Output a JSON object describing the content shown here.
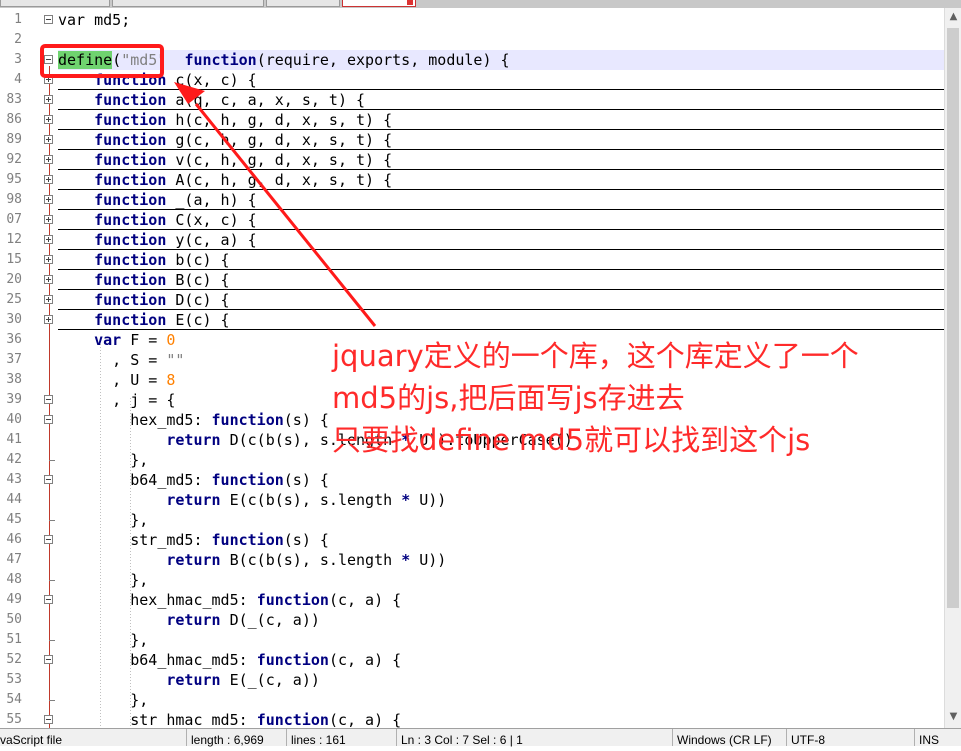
{
  "lines": [
    {
      "num": "1",
      "tokens": [
        {
          "t": "var md5;",
          "c": ""
        }
      ]
    },
    {
      "num": "2",
      "tokens": []
    },
    {
      "num": "3",
      "tokens": [
        {
          "t": "define",
          "c": "hl-define"
        },
        {
          "t": "(",
          "c": ""
        },
        {
          "t": "\"md5\"",
          "c": "str"
        },
        {
          "t": "  ",
          "c": ""
        },
        {
          "t": "function",
          "c": "kw"
        },
        {
          "t": "(require, exports, module) {",
          "c": ""
        }
      ]
    },
    {
      "num": "4",
      "tokens": [
        {
          "t": "    ",
          "c": ""
        },
        {
          "t": "function",
          "c": "kw"
        },
        {
          "t": " c(x, c) {",
          "c": ""
        }
      ]
    },
    {
      "num": "83",
      "tokens": [
        {
          "t": "    ",
          "c": ""
        },
        {
          "t": "function",
          "c": "kw"
        },
        {
          "t": " a(q, c, a, x, s, t) {",
          "c": ""
        }
      ]
    },
    {
      "num": "86",
      "tokens": [
        {
          "t": "    ",
          "c": ""
        },
        {
          "t": "function",
          "c": "kw"
        },
        {
          "t": " h(c, h, g, d, x, s, t) {",
          "c": ""
        }
      ]
    },
    {
      "num": "89",
      "tokens": [
        {
          "t": "    ",
          "c": ""
        },
        {
          "t": "function",
          "c": "kw"
        },
        {
          "t": " g(c, h, g, d, x, s, t) {",
          "c": ""
        }
      ]
    },
    {
      "num": "92",
      "tokens": [
        {
          "t": "    ",
          "c": ""
        },
        {
          "t": "function",
          "c": "kw"
        },
        {
          "t": " v(c, h, g, d, x, s, t) {",
          "c": ""
        }
      ]
    },
    {
      "num": "95",
      "tokens": [
        {
          "t": "    ",
          "c": ""
        },
        {
          "t": "function",
          "c": "kw"
        },
        {
          "t": " A(c, h, g, d, x, s, t) {",
          "c": ""
        }
      ]
    },
    {
      "num": "98",
      "tokens": [
        {
          "t": "    ",
          "c": ""
        },
        {
          "t": "function",
          "c": "kw"
        },
        {
          "t": " _(a, h) {",
          "c": ""
        }
      ]
    },
    {
      "num": "07",
      "tokens": [
        {
          "t": "    ",
          "c": ""
        },
        {
          "t": "function",
          "c": "kw"
        },
        {
          "t": " C(x, c) {",
          "c": ""
        }
      ]
    },
    {
      "num": "12",
      "tokens": [
        {
          "t": "    ",
          "c": ""
        },
        {
          "t": "function",
          "c": "kw"
        },
        {
          "t": " y(c, a) {",
          "c": ""
        }
      ]
    },
    {
      "num": "15",
      "tokens": [
        {
          "t": "    ",
          "c": ""
        },
        {
          "t": "function",
          "c": "kw"
        },
        {
          "t": " b(c) {",
          "c": ""
        }
      ]
    },
    {
      "num": "20",
      "tokens": [
        {
          "t": "    ",
          "c": ""
        },
        {
          "t": "function",
          "c": "kw"
        },
        {
          "t": " B(c) {",
          "c": ""
        }
      ]
    },
    {
      "num": "25",
      "tokens": [
        {
          "t": "    ",
          "c": ""
        },
        {
          "t": "function",
          "c": "kw"
        },
        {
          "t": " D(c) {",
          "c": ""
        }
      ]
    },
    {
      "num": "30",
      "tokens": [
        {
          "t": "    ",
          "c": ""
        },
        {
          "t": "function",
          "c": "kw"
        },
        {
          "t": " E(c) {",
          "c": ""
        }
      ]
    },
    {
      "num": "36",
      "tokens": [
        {
          "t": "    ",
          "c": ""
        },
        {
          "t": "var",
          "c": "kw"
        },
        {
          "t": " F = ",
          "c": ""
        },
        {
          "t": "0",
          "c": "num"
        }
      ]
    },
    {
      "num": "37",
      "tokens": [
        {
          "t": "      , S = ",
          "c": ""
        },
        {
          "t": "\"\"",
          "c": "str"
        }
      ]
    },
    {
      "num": "38",
      "tokens": [
        {
          "t": "      , U = ",
          "c": ""
        },
        {
          "t": "8",
          "c": "num"
        }
      ]
    },
    {
      "num": "39",
      "tokens": [
        {
          "t": "      , j = {",
          "c": ""
        }
      ]
    },
    {
      "num": "40",
      "tokens": [
        {
          "t": "        hex_md5: ",
          "c": ""
        },
        {
          "t": "function",
          "c": "kw"
        },
        {
          "t": "(s) {",
          "c": ""
        }
      ]
    },
    {
      "num": "41",
      "tokens": [
        {
          "t": "            ",
          "c": ""
        },
        {
          "t": "return",
          "c": "kw"
        },
        {
          "t": " D(c(b(s), s.length ",
          "c": ""
        },
        {
          "t": "*",
          "c": "op"
        },
        {
          "t": " U)).toUpperCase()",
          "c": ""
        }
      ]
    },
    {
      "num": "42",
      "tokens": [
        {
          "t": "        },",
          "c": ""
        }
      ]
    },
    {
      "num": "43",
      "tokens": [
        {
          "t": "        b64_md5: ",
          "c": ""
        },
        {
          "t": "function",
          "c": "kw"
        },
        {
          "t": "(s) {",
          "c": ""
        }
      ]
    },
    {
      "num": "44",
      "tokens": [
        {
          "t": "            ",
          "c": ""
        },
        {
          "t": "return",
          "c": "kw"
        },
        {
          "t": " E(c(b(s), s.length ",
          "c": ""
        },
        {
          "t": "*",
          "c": "op"
        },
        {
          "t": " U))",
          "c": ""
        }
      ]
    },
    {
      "num": "45",
      "tokens": [
        {
          "t": "        },",
          "c": ""
        }
      ]
    },
    {
      "num": "46",
      "tokens": [
        {
          "t": "        str_md5: ",
          "c": ""
        },
        {
          "t": "function",
          "c": "kw"
        },
        {
          "t": "(s) {",
          "c": ""
        }
      ]
    },
    {
      "num": "47",
      "tokens": [
        {
          "t": "            ",
          "c": ""
        },
        {
          "t": "return",
          "c": "kw"
        },
        {
          "t": " B(c(b(s), s.length ",
          "c": ""
        },
        {
          "t": "*",
          "c": "op"
        },
        {
          "t": " U))",
          "c": ""
        }
      ]
    },
    {
      "num": "48",
      "tokens": [
        {
          "t": "        },",
          "c": ""
        }
      ]
    },
    {
      "num": "49",
      "tokens": [
        {
          "t": "        hex_hmac_md5: ",
          "c": ""
        },
        {
          "t": "function",
          "c": "kw"
        },
        {
          "t": "(c, a) {",
          "c": ""
        }
      ]
    },
    {
      "num": "50",
      "tokens": [
        {
          "t": "            ",
          "c": ""
        },
        {
          "t": "return",
          "c": "kw"
        },
        {
          "t": " D(_(c, a))",
          "c": ""
        }
      ]
    },
    {
      "num": "51",
      "tokens": [
        {
          "t": "        },",
          "c": ""
        }
      ]
    },
    {
      "num": "52",
      "tokens": [
        {
          "t": "        b64_hmac_md5: ",
          "c": ""
        },
        {
          "t": "function",
          "c": "kw"
        },
        {
          "t": "(c, a) {",
          "c": ""
        }
      ]
    },
    {
      "num": "53",
      "tokens": [
        {
          "t": "            ",
          "c": ""
        },
        {
          "t": "return",
          "c": "kw"
        },
        {
          "t": " E(_(c, a))",
          "c": ""
        }
      ]
    },
    {
      "num": "54",
      "tokens": [
        {
          "t": "        },",
          "c": ""
        }
      ]
    },
    {
      "num": "55",
      "tokens": [
        {
          "t": "        str_hmac_md5: ",
          "c": ""
        },
        {
          "t": "function",
          "c": "kw"
        },
        {
          "t": "(c, a) {",
          "c": ""
        }
      ]
    }
  ],
  "fold_markers": [
    "minus",
    "",
    "minus",
    "plus",
    "plus",
    "plus",
    "plus",
    "plus",
    "plus",
    "plus",
    "plus",
    "plus",
    "plus",
    "plus",
    "plus",
    "plus",
    "",
    "",
    "",
    "minus",
    "minus",
    "",
    "end",
    "minus",
    "",
    "end",
    "minus",
    "",
    "end",
    "minus",
    "",
    "end",
    "minus",
    "",
    "end",
    "minus"
  ],
  "collapsed": [
    false,
    false,
    false,
    true,
    true,
    true,
    true,
    true,
    true,
    true,
    true,
    true,
    true,
    true,
    true,
    true
  ],
  "status": {
    "file_type": "vaScript file",
    "length": "length : 6,969",
    "lines": "lines : 161",
    "position": "Ln : 3    Col : 7    Sel : 6 | 1",
    "eol": "Windows (CR LF)",
    "encoding": "UTF-8",
    "mode": "INS"
  },
  "annotation": {
    "line1": "jquary定义的一个库，这个库定义了一个",
    "line2": "md5的js,把后面写js存进去",
    "line3": "只要找define md5就可以找到这个js"
  },
  "colors": {
    "annotation": "#ff2a2a",
    "keyword": "#000080",
    "define_highlight": "#6fd36f",
    "number": "#ff8000"
  },
  "icons": {
    "scroll_up": "up-arrow-icon",
    "scroll_down": "down-arrow-icon"
  }
}
